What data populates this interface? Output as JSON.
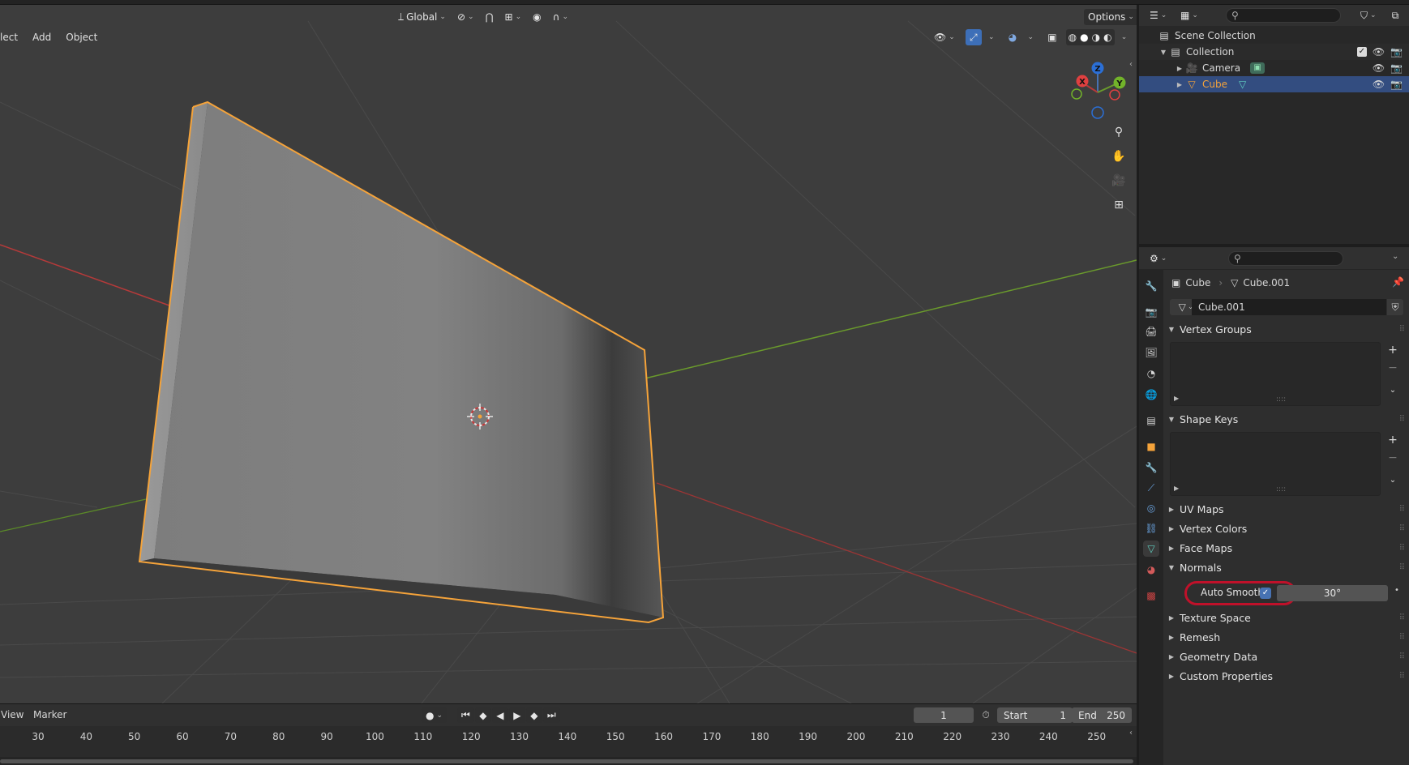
{
  "viewport": {
    "menu": [
      "lect",
      "Add",
      "Object"
    ],
    "transform_orientation": "Global",
    "options_label": "Options",
    "gizmo_axes": {
      "x": "X",
      "y": "Y",
      "z": "Z"
    }
  },
  "timeline": {
    "menu": [
      "View",
      "Marker"
    ],
    "current_frame": "1",
    "start_label": "Start",
    "start_value": "1",
    "end_label": "End",
    "end_value": "250",
    "ticks": [
      "30",
      "40",
      "50",
      "60",
      "70",
      "80",
      "90",
      "100",
      "110",
      "120",
      "130",
      "140",
      "150",
      "160",
      "170",
      "180",
      "190",
      "200",
      "210",
      "220",
      "230",
      "240",
      "250"
    ]
  },
  "outliner": {
    "rows": [
      {
        "label": "Scene Collection"
      },
      {
        "label": "Collection"
      },
      {
        "label": "Camera"
      },
      {
        "label": "Cube"
      }
    ]
  },
  "properties": {
    "breadcrumb_object": "Cube",
    "breadcrumb_mesh": "Cube.001",
    "mesh_name": "Cube.001",
    "panels": {
      "vertex_groups": "Vertex Groups",
      "shape_keys": "Shape Keys",
      "uv_maps": "UV Maps",
      "vertex_colors": "Vertex Colors",
      "face_maps": "Face Maps",
      "normals": "Normals",
      "texture_space": "Texture Space",
      "remesh": "Remesh",
      "geometry_data": "Geometry Data",
      "custom_properties": "Custom Properties"
    },
    "auto_smooth_label": "Auto Smooth",
    "auto_smooth_checked": true,
    "auto_smooth_angle": "30°"
  },
  "colors": {
    "selection_orange": "#f5a33a",
    "highlight_ring": "#c0112a",
    "x_axis": "#b53a3a",
    "y_axis": "#6a9a2c",
    "accent_blue": "#4772b3"
  }
}
